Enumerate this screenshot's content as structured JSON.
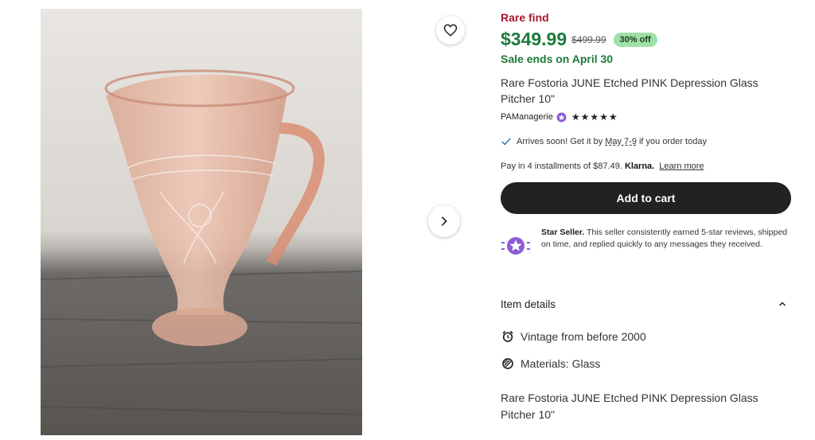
{
  "listing": {
    "rare_label": "Rare find",
    "price": "$349.99",
    "original_price": "$499.99",
    "discount": "30% off",
    "sale_ends": "Sale ends on April 30",
    "title": "Rare Fostoria JUNE Etched PINK Depression Glass Pitcher 10\""
  },
  "seller": {
    "name": "PAManagerie",
    "stars": "★★★★★",
    "rating": 5
  },
  "shipping": {
    "prefix": "Arrives soon! Get it by",
    "dates": "May 7-9",
    "suffix": "if you order today"
  },
  "payment": {
    "text": "Pay in 4 installments of $87.49.",
    "provider": "Klarna.",
    "learn_more": "Learn more"
  },
  "cart": {
    "label": "Add to cart"
  },
  "star_seller": {
    "title": "Star Seller.",
    "text": "This seller consistently earned 5-star reviews, shipped on time, and replied quickly to any messages they received."
  },
  "item_details": {
    "heading": "Item details",
    "rows": [
      {
        "icon": "alarm-clock-icon",
        "text": "Vintage from before 2000"
      },
      {
        "icon": "fabric-swatch-icon",
        "text": "Materials: Glass"
      }
    ],
    "description": "Rare Fostoria JUNE Etched PINK Depression Glass Pitcher 10\""
  },
  "colors": {
    "rare": "#a61a2e",
    "price_green": "#1d7a3b",
    "discount_bg": "#9fe0a6",
    "cart_bg": "#222222",
    "star_seller_purple": "#8b5cd6",
    "check_blue": "#2a6ebb"
  },
  "icons": {
    "favorite": "heart-icon",
    "next": "chevron-right-icon",
    "collapse": "chevron-up-icon",
    "check": "check-icon",
    "seller_badge": "star-seller-badge-icon"
  }
}
